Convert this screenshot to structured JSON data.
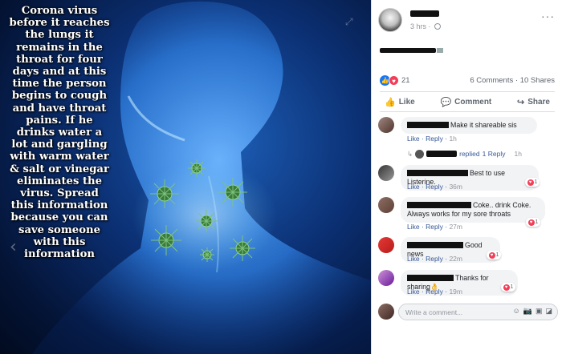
{
  "image": {
    "caption": "Corona virus\nbefore it reaches\nthe lungs it\nremains in the\nthroat for four\ndays and at this\ntime the person\nbegins to cough\nand have throat\npains. If he\ndrinks water a\nlot and gargling\nwith warm water\n& salt or vinegar\neliminates the\nvirus. Spread\nthis information\nbecause you can\nsave someone\nwith this\ninformation",
    "nav_arrow": "‹",
    "expand_icon": "expand-icon"
  },
  "post": {
    "meta_time": "3 hrs",
    "more_icon": "···",
    "reaction_count": "21",
    "comments_count": "6 Comments",
    "shares_count": "10 Shares",
    "actions": {
      "like": "Like",
      "comment": "Comment",
      "share": "Share"
    }
  },
  "comments": [
    {
      "text": "Make it shareable sis",
      "links": "Like · Reply · ",
      "time": "1h"
    },
    {
      "text": "Best to use Listerine.",
      "links": "Like · Reply · ",
      "time": "36m",
      "reaction": "1"
    },
    {
      "text": "Coke.. drink Coke.\nAlways works for my sore throats",
      "links": "Like · Reply · ",
      "time": "27m",
      "reaction": "1"
    },
    {
      "text": "Good news",
      "links": "Like · Reply · ",
      "time": "22m",
      "reaction": "1"
    },
    {
      "text": "Thanks for sharing",
      "emoji": "👌",
      "links": "Like · Reply · ",
      "time": "19m",
      "reaction": "1"
    }
  ],
  "reply_thread": {
    "arrow": "↳",
    "replied": "replied",
    "replies": "1 Reply",
    "time": "1h"
  },
  "composer": {
    "placeholder": "Write a comment...",
    "icons": [
      "emoji-icon",
      "camera-icon",
      "gif-icon",
      "sticker-icon"
    ]
  },
  "colors": {
    "link": "#385898",
    "like_blue": "#1877f2",
    "love_red": "#f33e58"
  }
}
